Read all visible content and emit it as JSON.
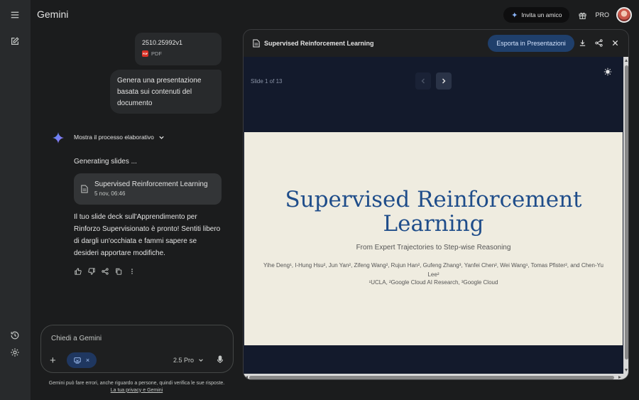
{
  "app": {
    "brand": "Gemini"
  },
  "header": {
    "invite_label": "Invita un amico",
    "plan": "PRO"
  },
  "chat": {
    "file": {
      "name": "2510.25992v1",
      "type": "PDF"
    },
    "user_message": "Genera una presentazione basata sui contenuti del documento",
    "process_label": "Mostra il processo elaborativo",
    "generating": "Generating slides ...",
    "card": {
      "title": "Supervised Reinforcement Learning",
      "date": "5 nov, 06:46"
    },
    "reply": "Il tuo slide deck sull'Apprendimento per Rinforzo Supervisionato è pronto! Sentiti libero di dargli un'occhiata e fammi sapere se desideri apportare modifiche."
  },
  "composer": {
    "placeholder": "Chiedi a Gemini",
    "model": "2.5 Pro",
    "chip_close": "×",
    "disclaimer": "Gemini può fare errori, anche riguardo a persone, quindi verifica le sue risposte.",
    "privacy_link": "La tua privacy e Gemini"
  },
  "panel": {
    "title": "Supervised Reinforcement Learning",
    "export_label": "Esporta in Presentazioni",
    "slide_counter": "Slide 1 of 13"
  },
  "slide": {
    "title": "Supervised Reinforcement Learning",
    "subtitle": "From Expert Trajectories to Step-wise Reasoning",
    "authors": "Yihe Deng¹, I-Hung Hsu², Jun Yan², Zifeng Wang², Rujun Han², Gufeng Zhang³, Yanfei Chen², Wei Wang¹, Tomas Pfister², and Chen-Yu Lee²",
    "affiliations": "¹UCLA, ²Google Cloud AI Research, ³Google Cloud"
  },
  "colors": {
    "background": "#1b1c1d",
    "rail": "#282a2c",
    "accent": "#8ab4f8",
    "export_button": "#1f3f6b",
    "slide_background": "#efece0",
    "slide_title": "#1f4d8a",
    "viewer_background": "#131a2c"
  }
}
